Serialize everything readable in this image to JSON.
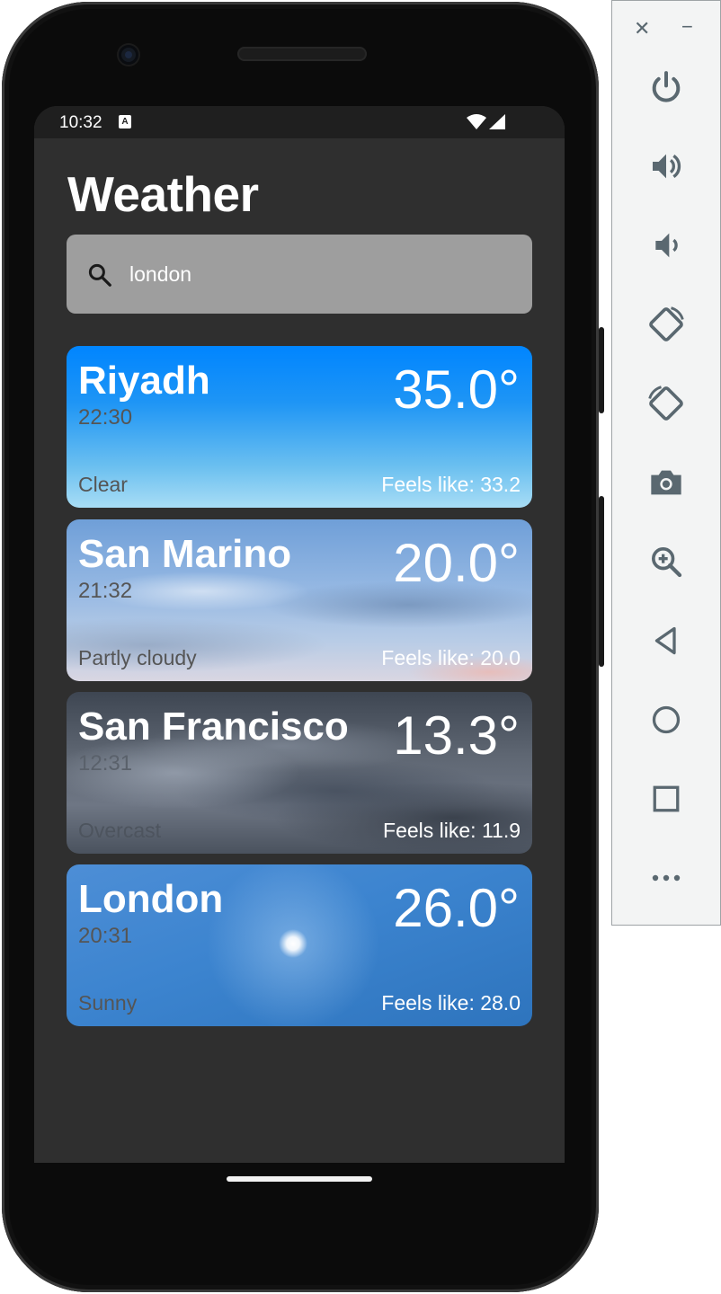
{
  "status_bar": {
    "time": "10:32",
    "notification_letter": "A"
  },
  "app": {
    "title": "Weather"
  },
  "search": {
    "value": "london",
    "placeholder": ""
  },
  "cards": [
    {
      "city": "Riyadh",
      "time": "22:30",
      "temp": "35.0°",
      "condition": "Clear",
      "feels": "Feels like: 33.2",
      "icon": "clear-sky"
    },
    {
      "city": "San Marino",
      "time": "21:32",
      "temp": "20.0°",
      "condition": "Partly cloudy",
      "feels": "Feels like: 20.0",
      "icon": "partly-cloudy-sky"
    },
    {
      "city": "San Francisco",
      "time": "12:31",
      "temp": "13.3°",
      "condition": "Overcast",
      "feels": "Feels like: 11.9",
      "icon": "overcast-sky"
    },
    {
      "city": "London",
      "time": "20:31",
      "temp": "26.0°",
      "condition": "Sunny",
      "feels": "Feels like: 28.0",
      "icon": "sunny-sky"
    }
  ],
  "toolbar_buttons": [
    "power-icon",
    "volume-up-icon",
    "volume-down-icon",
    "rotate-left-icon",
    "rotate-right-icon",
    "camera-icon",
    "zoom-icon",
    "back-icon",
    "home-icon",
    "overview-icon",
    "more-icon"
  ],
  "colors": {
    "screen_bg": "#2f2f2f",
    "search_bg": "#9e9e9e",
    "toolbar_bg": "#f3f4f4",
    "toolbar_icon": "#5a6870"
  }
}
